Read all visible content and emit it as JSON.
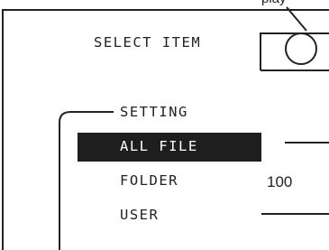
{
  "callout": {
    "label": "play"
  },
  "header": {
    "label": "SELECT ITEM"
  },
  "menu": {
    "title": "SETTING",
    "items": [
      {
        "label": "ALL FILE",
        "value": "",
        "selected": true
      },
      {
        "label": "FOLDER",
        "value": "100",
        "selected": false
      },
      {
        "label": "USER",
        "value": "",
        "selected": false
      }
    ]
  },
  "colors": {
    "line": "#222222",
    "highlight_bg": "#1e1e1e",
    "highlight_text": "#ffffff",
    "background": "#ffffff"
  }
}
